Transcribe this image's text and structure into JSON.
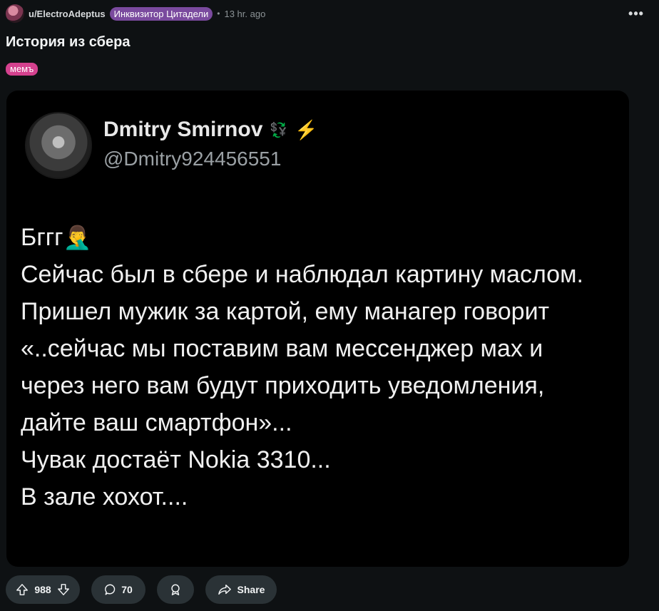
{
  "post": {
    "author": "u/ElectroAdeptus",
    "author_flair": "Инквизитор Цитадели",
    "separator": "•",
    "time_ago": "13 hr. ago",
    "more_label": "•••",
    "title": "История из сбера",
    "tag": "мемъ"
  },
  "tweet": {
    "name": "Dmitry Smirnov",
    "name_badge": "💱",
    "name_bolt": "⚡",
    "handle": "@Dmitry924456551",
    "lines": [
      "Бггг",
      "Сейчас был в сбере и наблюдал картину маслом. Пришел мужик за картой, ему манагер говорит «..сейчас мы поставим вам мессенджер мах и через него вам будут приходить уведомления, дайте ваш смартфон»...",
      "Чувак достаёт Nokia 3310...",
      "В зале хохот...."
    ],
    "emoji": "🤦‍♂️"
  },
  "actions": {
    "score": "988",
    "comments": "70",
    "share_label": "Share"
  }
}
